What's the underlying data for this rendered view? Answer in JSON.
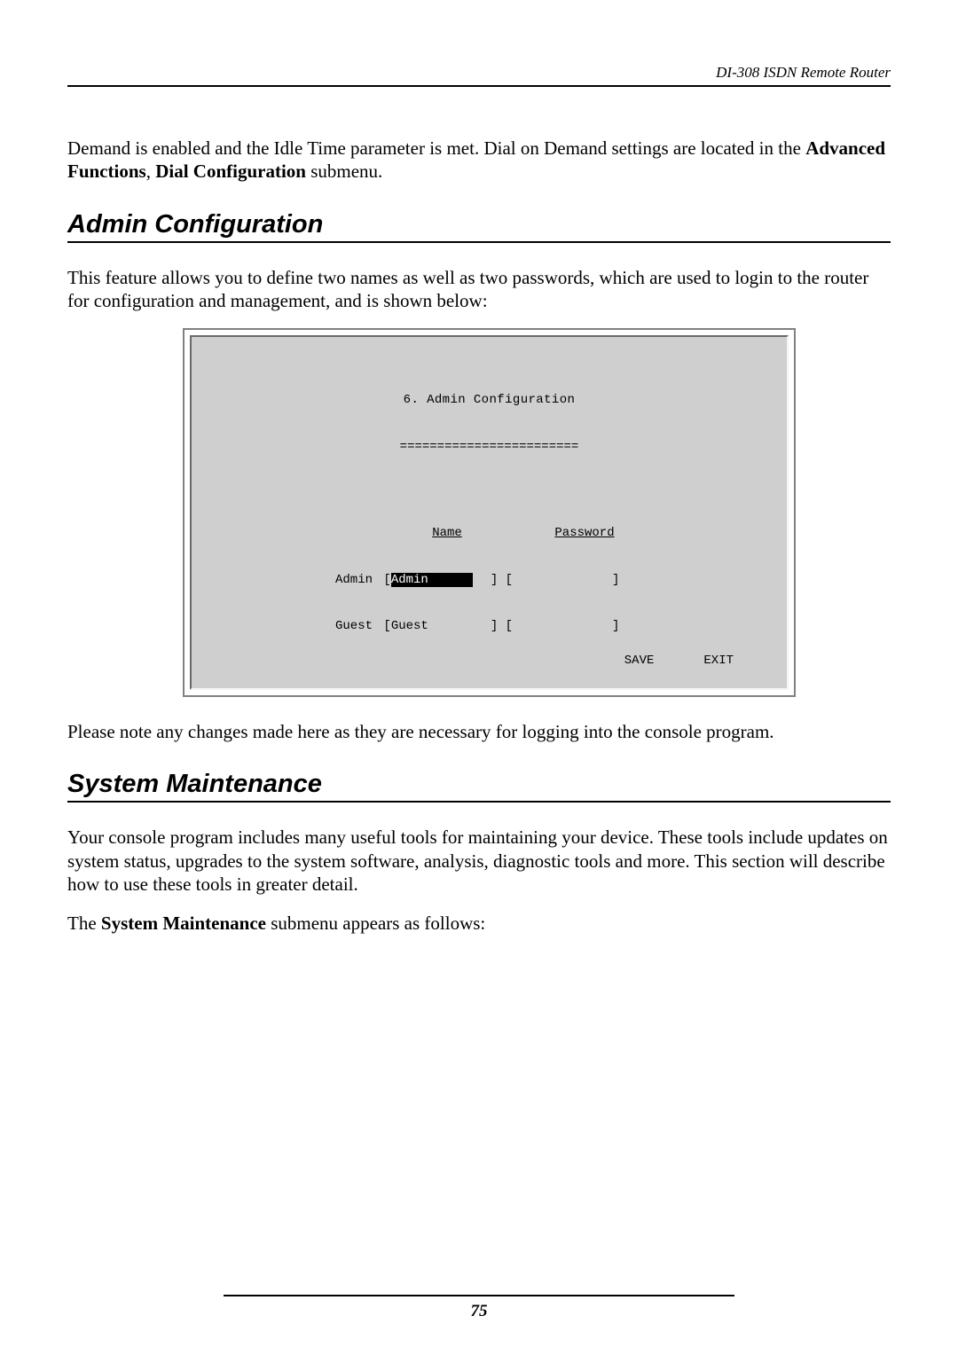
{
  "header": {
    "running": "DI-308 ISDN Remote Router"
  },
  "intro": {
    "pre": "Demand is enabled and the Idle Time parameter is met. Dial on Demand settings are located in the ",
    "bold1": "Advanced Functions",
    "sep": ", ",
    "bold2": "Dial Configuration",
    "post": " submenu."
  },
  "section1": {
    "heading": "Admin Configuration",
    "para": "This feature allows you to define two names as well as two passwords, which are used to login to the router for configuration and management, and is shown below:",
    "note": "Please note any changes made here as they are necessary for logging into the console program."
  },
  "terminal": {
    "title": "6. Admin Configuration",
    "divider": "========================",
    "headers": {
      "name": "Name",
      "password": "Password"
    },
    "rows": [
      {
        "label": "Admin",
        "name": "Admin",
        "password": ""
      },
      {
        "label": "Guest",
        "name": "Guest",
        "password": ""
      }
    ],
    "actions": {
      "save": "SAVE",
      "exit": "EXIT"
    }
  },
  "section2": {
    "heading": "System Maintenance",
    "para1": "Your console program includes many useful tools for maintaining your device. These tools include updates on system status, upgrades to the system software, analysis, diagnostic tools and more. This section will describe how to use these tools in greater detail.",
    "para2_pre": "The ",
    "para2_bold": "System Maintenance",
    "para2_post": " submenu appears as follows:"
  },
  "footer": {
    "page": "75"
  }
}
